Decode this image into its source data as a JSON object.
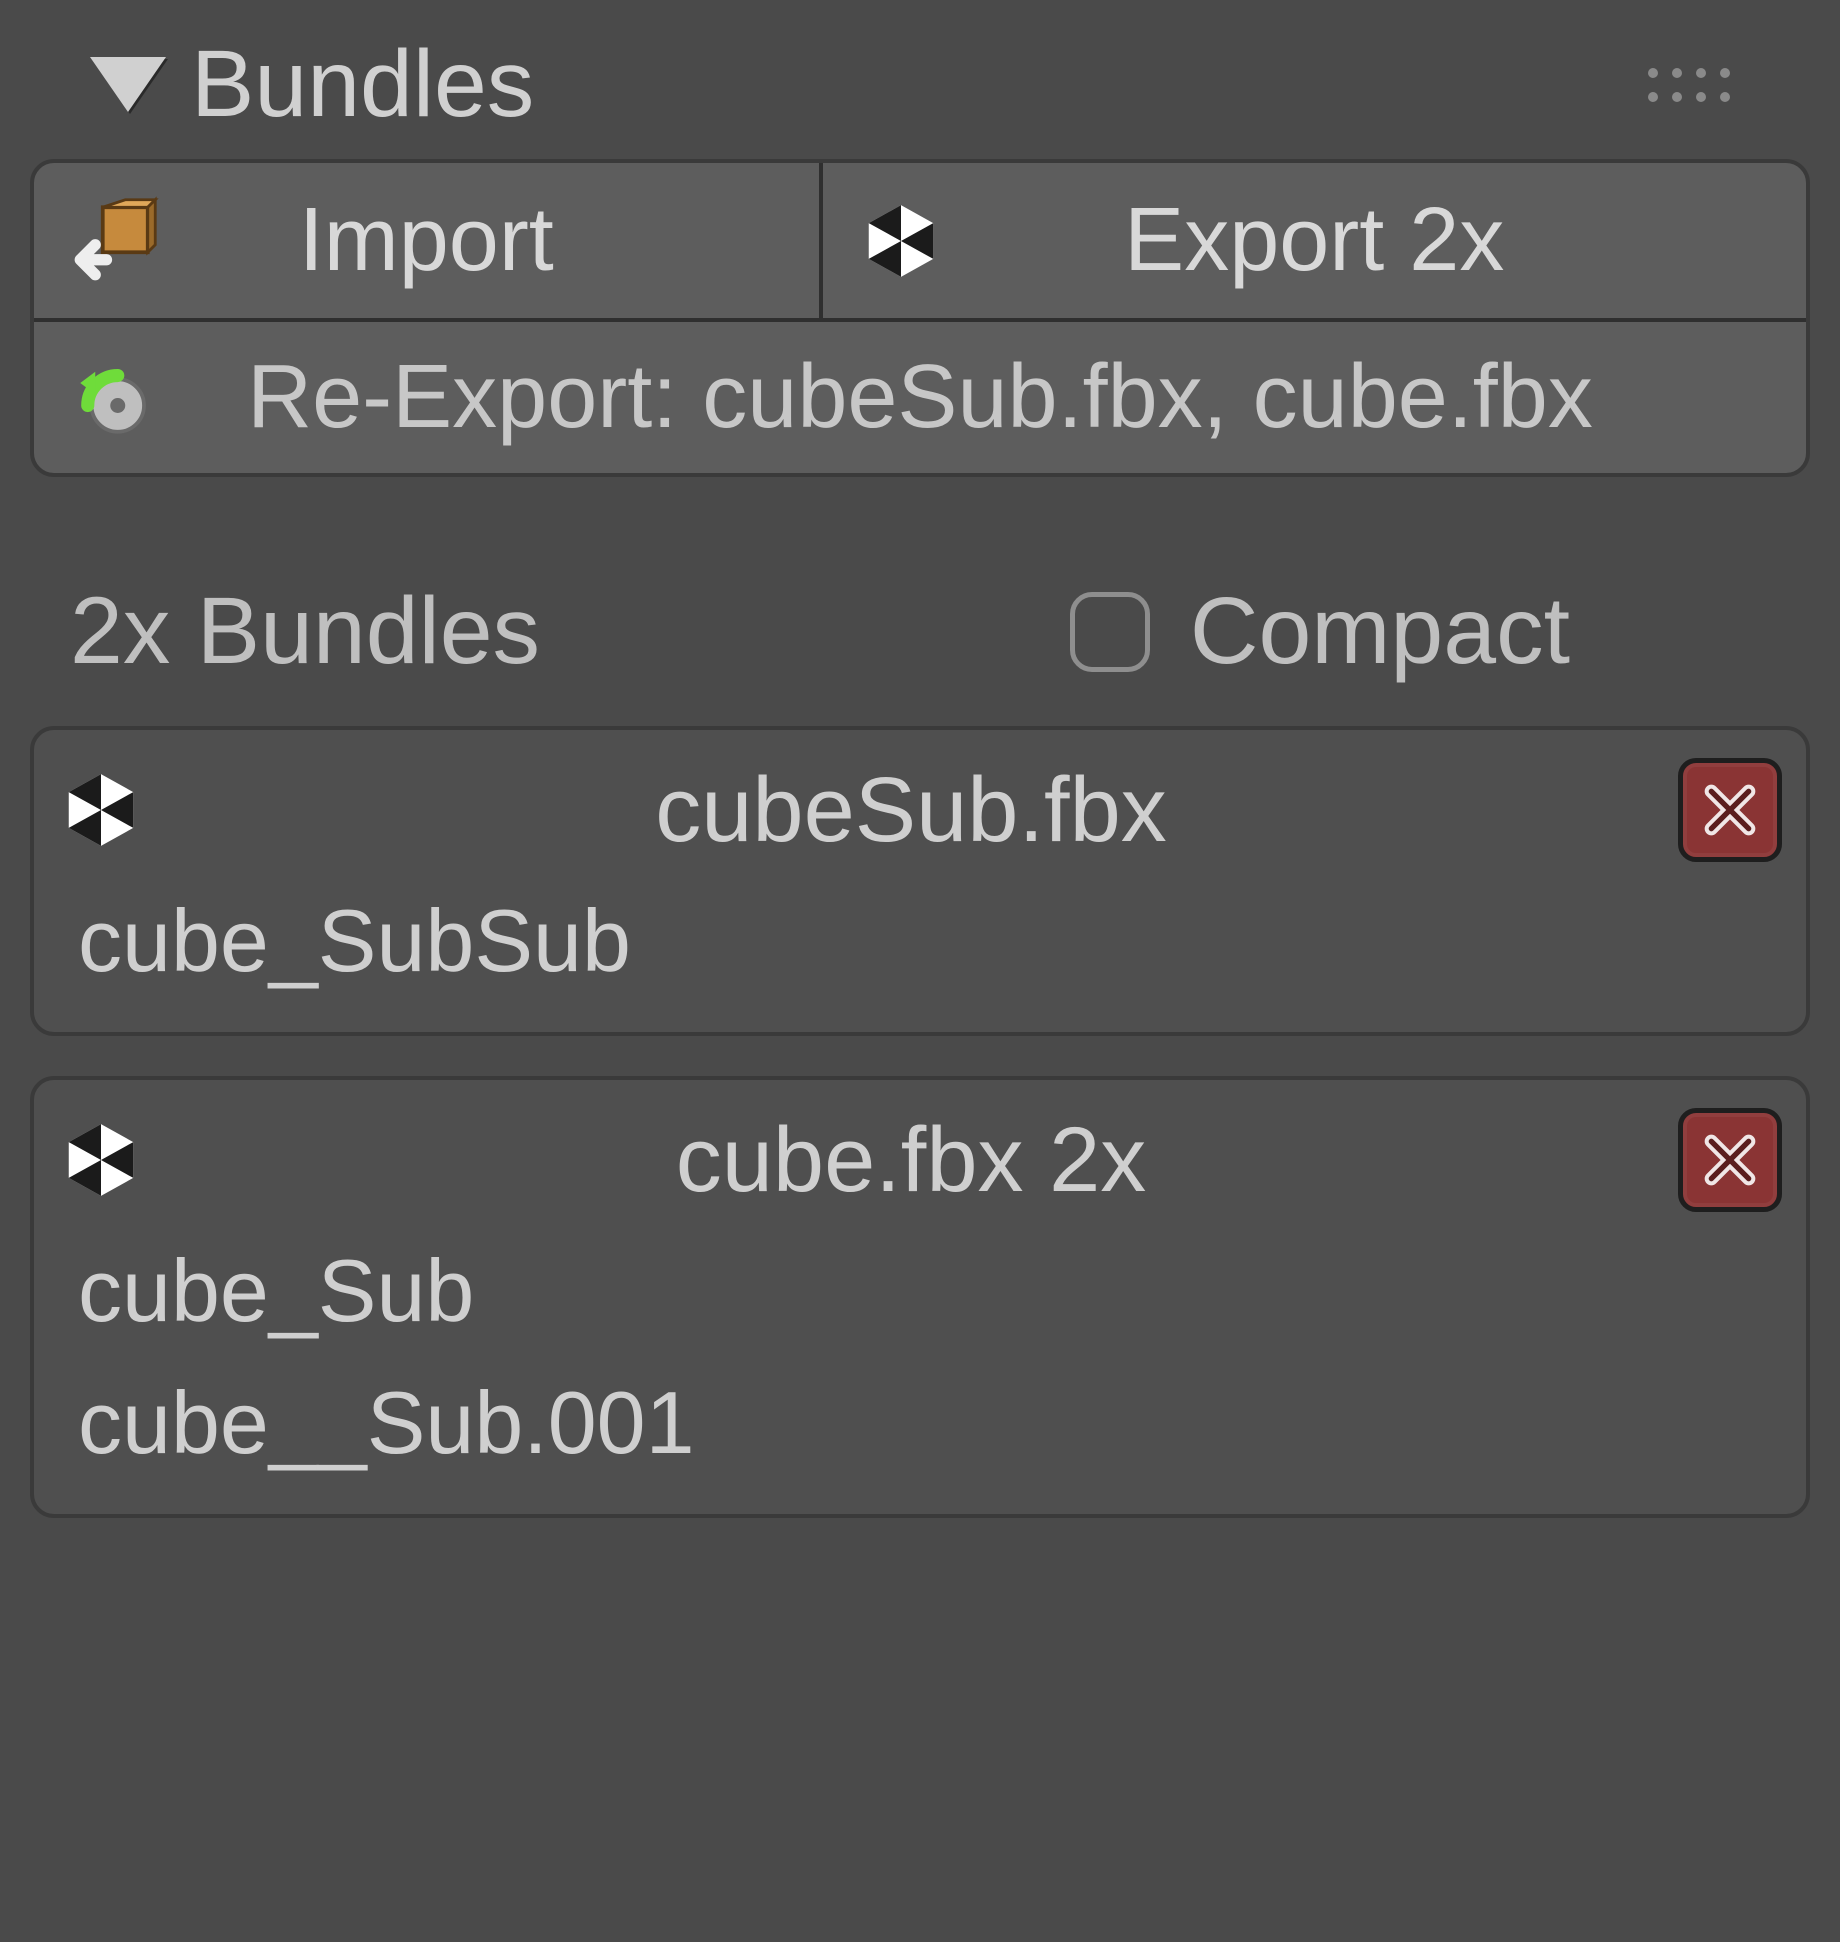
{
  "panel": {
    "title": "Bundles"
  },
  "toolbar": {
    "import_label": "Import",
    "export_label": "Export 2x",
    "reexport_label": "Re-Export: cubeSub.fbx, cube.fbx"
  },
  "section": {
    "count_label": "2x Bundles",
    "compact_label": "Compact",
    "compact_checked": false
  },
  "bundles": [
    {
      "file": "cubeSub.fbx",
      "items": [
        "cube_SubSub"
      ]
    },
    {
      "file": "cube.fbx  2x",
      "items": [
        "cube_Sub",
        "cube__Sub.001"
      ]
    }
  ],
  "icons": {
    "import": "package-import-icon",
    "export": "unity-icon",
    "reexport": "refresh-icon",
    "bundle": "unity-icon",
    "delete": "close-x-icon"
  },
  "colors": {
    "panel_bg": "#4a4a4a",
    "button_bg": "#5d5d5d",
    "delete_bg": "#8a3434",
    "text": "#c7c7c7"
  }
}
